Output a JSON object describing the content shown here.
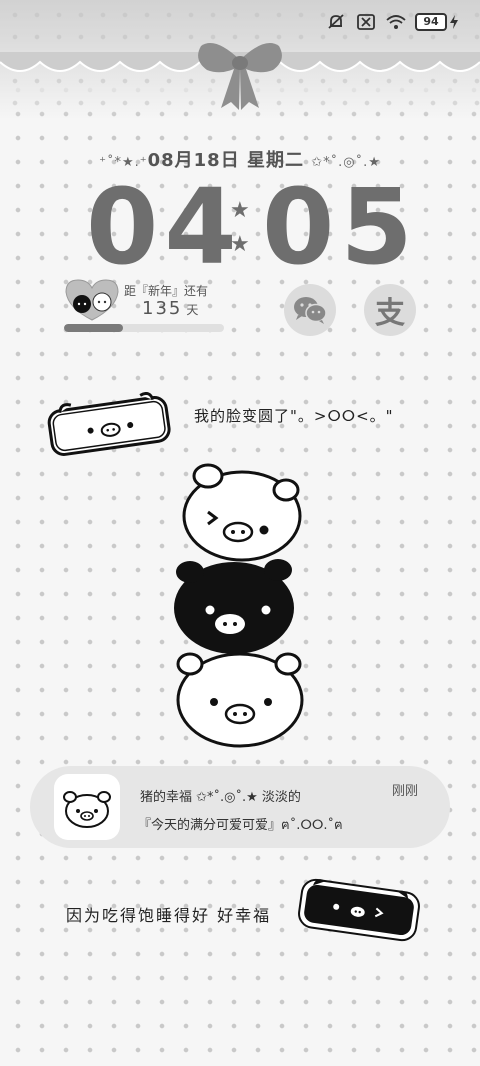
{
  "status_bar": {
    "icons": [
      "mute-icon",
      "no-sim-icon",
      "wifi-icon"
    ],
    "battery_level": "94",
    "charging": true
  },
  "date_line": {
    "prefix_deco": "⁺˚*★.⁺",
    "date": "08月18日",
    "weekday": "星期二",
    "suffix_deco": "✩*˚.◎˚.★"
  },
  "clock": {
    "hours": "04",
    "minutes": "05",
    "separator": "★"
  },
  "countdown": {
    "label": "距『新年』还有",
    "days": "135",
    "unit": "天",
    "progress": 0.37
  },
  "shortcuts": {
    "wechat": "wechat-icon",
    "alipay_label": "支"
  },
  "caption_top": "我的脸变圆了\"。>ⵔⵔ<。\"",
  "notification": {
    "title": "猪的幸福 ✩*˚.◎˚.★ 淡淡的",
    "body": "『今天的满分可爱可爱』ฅ˚.ⵔⵔ.˚ฅ",
    "time": "刚刚"
  },
  "caption_bottom": "因为吃得饱睡得好  好幸福",
  "colors": {
    "background": "#f6f6f6",
    "dots": "#c9c9c9",
    "clock": "#6e6e6e",
    "notification_bg": "#e6e6e6"
  }
}
